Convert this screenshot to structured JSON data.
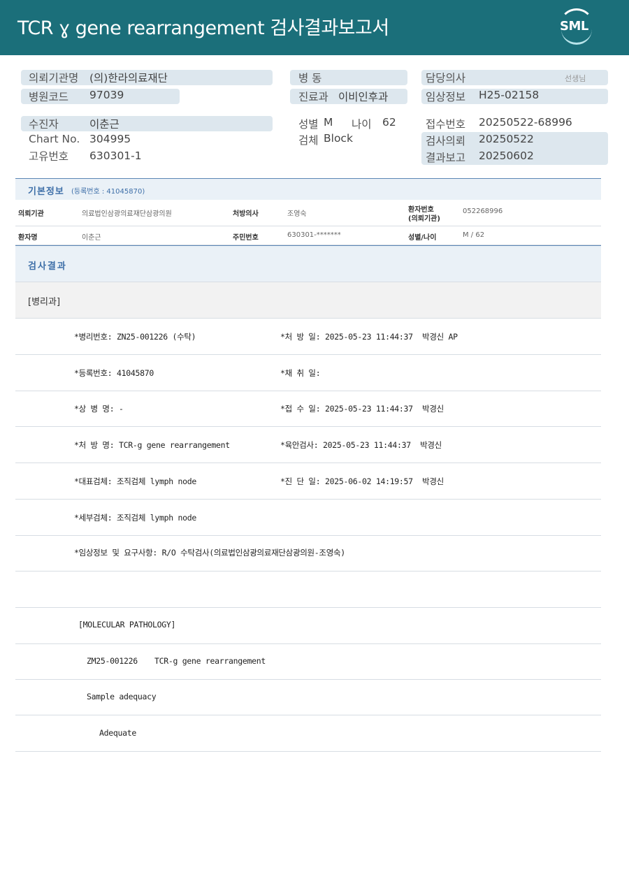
{
  "header": {
    "title": "TCR ɣ gene rearrangement 검사결과보고서",
    "logo": "SML"
  },
  "summary": {
    "institution_label": "의뢰기관명",
    "institution_value": "(의)한라의료재단",
    "hospital_code_label": "병원코드",
    "hospital_code_value": "97039",
    "ward_label": "병   동",
    "department_label": "진료과",
    "department_value": "이비인후과",
    "doctor_label": "담당의사",
    "doctor_suffix": "선생님",
    "clinical_label": "임상정보",
    "clinical_value": "H25-02158",
    "patient_label": "수진자",
    "patient_value": "이춘근",
    "chart_label": "Chart No.",
    "chart_value": "304995",
    "id_label": "고유번호",
    "id_value": "630301-1",
    "sex_label": "성별",
    "sex_value": "M",
    "age_label": "나이",
    "age_value": "62",
    "specimen_label": "검체",
    "specimen_value": "Block",
    "receipt_label": "접수번호",
    "receipt_value": "20250522-68996",
    "request_label": "검사의뢰",
    "request_value": "20250522",
    "report_label": "결과보고",
    "report_value": "20250602"
  },
  "basic_info": {
    "title": "기본정보",
    "reg_note": "(등록번호 : 41045870)",
    "row1": {
      "inst_label": "의뢰기관",
      "inst_value": "의료법인삼광의료재단삼광의원",
      "doctor_label": "처방의사",
      "doctor_value": "조영숙",
      "patno_label_1": "환자번호",
      "patno_label_2": "(의뢰기관)",
      "patno_value": "052268996"
    },
    "row2": {
      "name_label": "환자명",
      "name_value": "이춘근",
      "rrn_label": "주민번호",
      "rrn_value": "630301-*******",
      "sexage_label": "성별/나이",
      "sexage_value": "M / 62"
    }
  },
  "results": {
    "title": "검사결과",
    "dept": "[병리과]",
    "lines": [
      {
        "left": "*병리번호: ZN25-001226 (수탁)",
        "right": "*처 방 일: 2025-05-23 11:44:37  박경신 AP"
      },
      {
        "left": "*등록번호: 41045870",
        "right": "*채 취 일:"
      },
      {
        "left": "*상 병 명: -",
        "right": "*접 수 일: 2025-05-23 11:44:37  박경신"
      },
      {
        "left": "*처 방 명: TCR-g gene rearrangement",
        "right": "*육안검사: 2025-05-23 11:44:37  박경신"
      },
      {
        "left": "*대표검체: 조직검체 lymph node",
        "right": "*진 단 일: 2025-06-02 14:19:57  박경신"
      },
      {
        "left": "*세부검체: 조직검체 lymph node",
        "right": ""
      },
      {
        "left": "*임상정보 및 요구사항: R/O 수탁검사(의료법인삼광의료재단삼광의원-조영숙)",
        "right": ""
      }
    ],
    "molecular_title": "[MOLECULAR PATHOLOGY]",
    "molecular_id": "ZM25-001226",
    "molecular_test": "TCR-g gene rearrangement",
    "adequacy_label": "Sample adequacy",
    "adequacy_value": "Adequate"
  }
}
